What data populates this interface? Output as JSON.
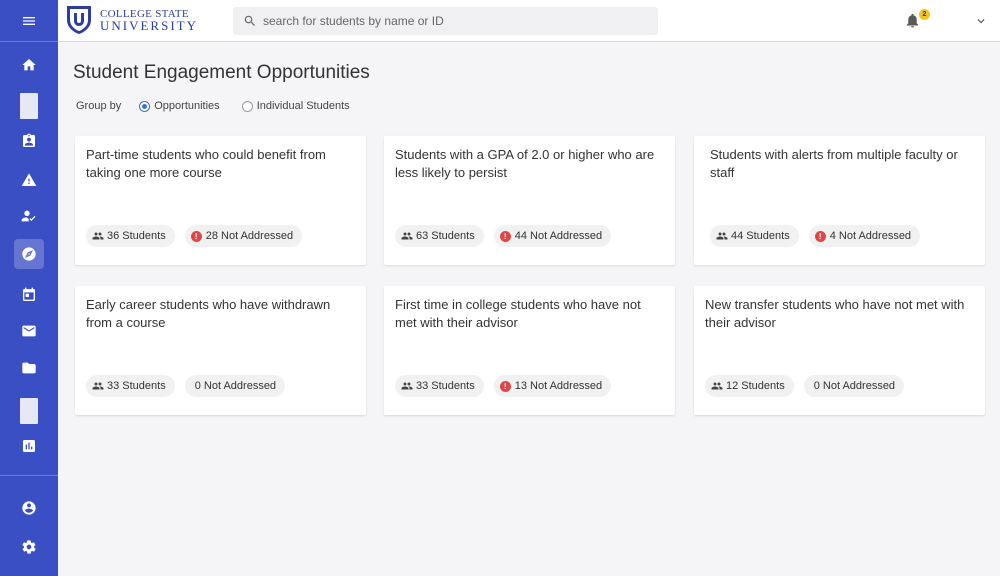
{
  "brand": {
    "line1": "COLLEGE STATE",
    "line2": "UNIVERSITY"
  },
  "search": {
    "placeholder": "search for students by name or ID"
  },
  "notifications": {
    "count": "2"
  },
  "page": {
    "title": "Student Engagement Opportunities"
  },
  "group_by": {
    "label": "Group by",
    "options": [
      "Opportunities",
      "Individual Students"
    ],
    "selected": "Opportunities"
  },
  "cards": [
    {
      "title": "Part-time students who could benefit from taking one more course",
      "students": "36 Students",
      "not_addressed": "28 Not Addressed",
      "alert": true
    },
    {
      "title": "Students with a GPA of 2.0 or higher who are less likely to persist",
      "students": "63 Students",
      "not_addressed": "44 Not Addressed",
      "alert": true
    },
    {
      "title": "Students with alerts from multiple faculty or staff",
      "students": "44 Students",
      "not_addressed": "4 Not Addressed",
      "alert": true
    },
    {
      "title": "Early career students who have withdrawn from a course",
      "students": "33 Students",
      "not_addressed": "0 Not Addressed",
      "alert": false
    },
    {
      "title": "First time in college students who have not met with their advisor",
      "students": "33 Students",
      "not_addressed": "13 Not Addressed",
      "alert": true
    },
    {
      "title": "New transfer students who have not met with their advisor",
      "students": "12 Students",
      "not_addressed": "0 Not Addressed",
      "alert": false
    }
  ],
  "sidebar": {
    "icons": [
      "menu-icon",
      "home-icon",
      "clipboard-icon",
      "warning-icon",
      "person-check-icon",
      "compass-icon",
      "calendar-icon",
      "mail-icon",
      "folder-icon",
      "bar-chart-icon",
      "account-icon",
      "settings-icon"
    ],
    "active": "compass-icon"
  },
  "colors": {
    "sidebar": "#3b4fc4",
    "accent": "#3b6fd4",
    "alert": "#e04646",
    "badge": "#f3c61b"
  }
}
